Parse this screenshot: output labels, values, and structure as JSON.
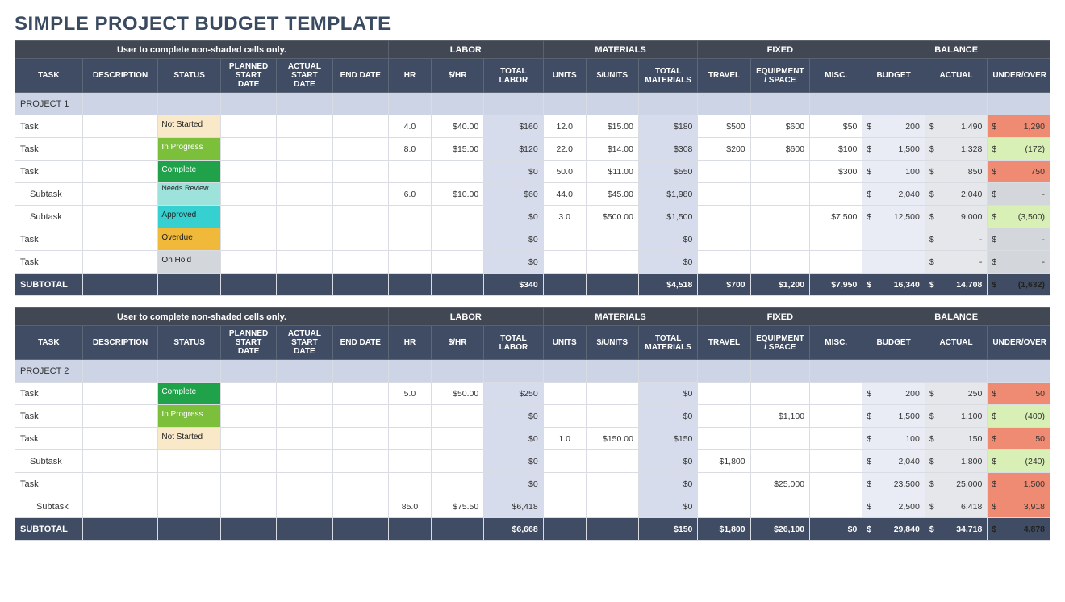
{
  "title": "SIMPLE PROJECT BUDGET TEMPLATE",
  "note": "User to complete non-shaded cells only.",
  "groups": {
    "labor": "LABOR",
    "materials": "MATERIALS",
    "fixed": "FIXED",
    "balance": "BALANCE"
  },
  "headers": {
    "task": "TASK",
    "description": "DESCRIPTION",
    "status": "STATUS",
    "plannedStart": "PLANNED START DATE",
    "actualStart": "ACTUAL START DATE",
    "endDate": "END DATE",
    "hr": "HR",
    "rate": "$/HR",
    "totalLabor": "TOTAL LABOR",
    "units": "UNITS",
    "unitPrice": "$/UNITS",
    "totalMaterials": "TOTAL MATERIALS",
    "travel": "TRAVEL",
    "equip": "EQUIPMENT / SPACE",
    "misc": "MISC.",
    "budget": "BUDGET",
    "actual": "ACTUAL",
    "underOver": "UNDER/OVER"
  },
  "statusMap": {
    "notstarted": "Not Started",
    "inprogress": "In Progress",
    "complete": "Complete",
    "needsreview": "Needs Review",
    "approved": "Approved",
    "overdue": "Overdue",
    "onhold": "On Hold"
  },
  "projects": [
    {
      "name": "PROJECT 1",
      "rows": [
        {
          "task": "Task",
          "indent": 0,
          "status": "notstarted",
          "hr": "4.0",
          "rate": "$40.00",
          "totalLabor": "$160",
          "units": "12.0",
          "unitPrice": "$15.00",
          "totalMaterials": "$180",
          "travel": "$500",
          "equip": "$600",
          "misc": "$50",
          "budget": "200",
          "actual": "1,490",
          "uo": "1,290",
          "uoClass": "u-over"
        },
        {
          "task": "Task",
          "indent": 0,
          "status": "inprogress",
          "hr": "8.0",
          "rate": "$15.00",
          "totalLabor": "$120",
          "units": "22.0",
          "unitPrice": "$14.00",
          "totalMaterials": "$308",
          "travel": "$200",
          "equip": "$600",
          "misc": "$100",
          "budget": "1,500",
          "actual": "1,328",
          "uo": "(172)",
          "uoClass": "u-under"
        },
        {
          "task": "Task",
          "indent": 0,
          "status": "complete",
          "hr": "",
          "rate": "",
          "totalLabor": "$0",
          "units": "50.0",
          "unitPrice": "$11.00",
          "totalMaterials": "$550",
          "travel": "",
          "equip": "",
          "misc": "$300",
          "budget": "100",
          "actual": "850",
          "uo": "750",
          "uoClass": "u-over"
        },
        {
          "task": "Subtask",
          "indent": 1,
          "status": "needsreview",
          "hr": "6.0",
          "rate": "$10.00",
          "totalLabor": "$60",
          "units": "44.0",
          "unitPrice": "$45.00",
          "totalMaterials": "$1,980",
          "travel": "",
          "equip": "",
          "misc": "",
          "budget": "2,040",
          "actual": "2,040",
          "uo": "-",
          "uoClass": "u-zero"
        },
        {
          "task": "Subtask",
          "indent": 1,
          "status": "approved",
          "hr": "",
          "rate": "",
          "totalLabor": "$0",
          "units": "3.0",
          "unitPrice": "$500.00",
          "totalMaterials": "$1,500",
          "travel": "",
          "equip": "",
          "misc": "$7,500",
          "budget": "12,500",
          "actual": "9,000",
          "uo": "(3,500)",
          "uoClass": "u-under"
        },
        {
          "task": "Task",
          "indent": 0,
          "status": "overdue",
          "hr": "",
          "rate": "",
          "totalLabor": "$0",
          "units": "",
          "unitPrice": "",
          "totalMaterials": "$0",
          "travel": "",
          "equip": "",
          "misc": "",
          "budget": "",
          "actual": "-",
          "uo": "-",
          "uoClass": "u-zero"
        },
        {
          "task": "Task",
          "indent": 0,
          "status": "onhold",
          "hr": "",
          "rate": "",
          "totalLabor": "$0",
          "units": "",
          "unitPrice": "",
          "totalMaterials": "$0",
          "travel": "",
          "equip": "",
          "misc": "",
          "budget": "",
          "actual": "-",
          "uo": "-",
          "uoClass": "u-zero"
        }
      ],
      "subtotal": {
        "label": "SUBTOTAL",
        "totalLabor": "$340",
        "totalMaterials": "$4,518",
        "travel": "$700",
        "equip": "$1,200",
        "misc": "$7,950",
        "budget": "16,340",
        "actual": "14,708",
        "uo": "(1,632)",
        "uoClass": "u-under"
      }
    },
    {
      "name": "PROJECT 2",
      "rows": [
        {
          "task": "Task",
          "indent": 0,
          "status": "complete",
          "hr": "5.0",
          "rate": "$50.00",
          "totalLabor": "$250",
          "units": "",
          "unitPrice": "",
          "totalMaterials": "$0",
          "travel": "",
          "equip": "",
          "misc": "",
          "budget": "200",
          "actual": "250",
          "uo": "50",
          "uoClass": "u-over"
        },
        {
          "task": "Task",
          "indent": 0,
          "status": "inprogress",
          "hr": "",
          "rate": "",
          "totalLabor": "$0",
          "units": "",
          "unitPrice": "",
          "totalMaterials": "$0",
          "travel": "",
          "equip": "$1,100",
          "misc": "",
          "budget": "1,500",
          "actual": "1,100",
          "uo": "(400)",
          "uoClass": "u-under"
        },
        {
          "task": "Task",
          "indent": 0,
          "status": "notstarted",
          "hr": "",
          "rate": "",
          "totalLabor": "$0",
          "units": "1.0",
          "unitPrice": "$150.00",
          "totalMaterials": "$150",
          "travel": "",
          "equip": "",
          "misc": "",
          "budget": "100",
          "actual": "150",
          "uo": "50",
          "uoClass": "u-over"
        },
        {
          "task": "Subtask",
          "indent": 1,
          "status": "",
          "hr": "",
          "rate": "",
          "totalLabor": "$0",
          "units": "",
          "unitPrice": "",
          "totalMaterials": "$0",
          "travel": "$1,800",
          "equip": "",
          "misc": "",
          "budget": "2,040",
          "actual": "1,800",
          "uo": "(240)",
          "uoClass": "u-under"
        },
        {
          "task": "Task",
          "indent": 0,
          "status": "",
          "hr": "",
          "rate": "",
          "totalLabor": "$0",
          "units": "",
          "unitPrice": "",
          "totalMaterials": "$0",
          "travel": "",
          "equip": "$25,000",
          "misc": "",
          "budget": "23,500",
          "actual": "25,000",
          "uo": "1,500",
          "uoClass": "u-over"
        },
        {
          "task": "Subtask",
          "indent": 2,
          "status": "",
          "hr": "85.0",
          "rate": "$75.50",
          "totalLabor": "$6,418",
          "units": "",
          "unitPrice": "",
          "totalMaterials": "$0",
          "travel": "",
          "equip": "",
          "misc": "",
          "budget": "2,500",
          "actual": "6,418",
          "uo": "3,918",
          "uoClass": "u-over"
        }
      ],
      "subtotal": {
        "label": "SUBTOTAL",
        "totalLabor": "$6,668",
        "totalMaterials": "$150",
        "travel": "$1,800",
        "equip": "$26,100",
        "misc": "$0",
        "budget": "29,840",
        "actual": "34,718",
        "uo": "4,878",
        "uoClass": "u-over"
      }
    }
  ]
}
